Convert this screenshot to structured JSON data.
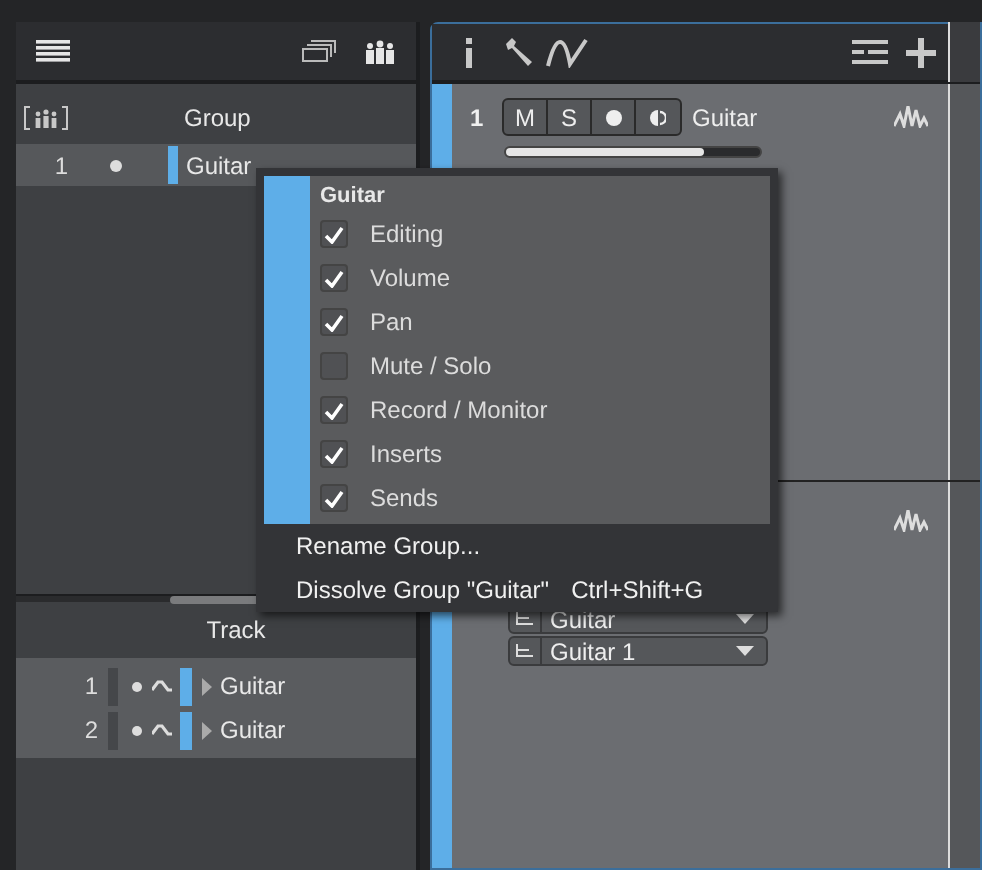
{
  "group_panel": {
    "header": "Group",
    "groups": [
      {
        "number": "1",
        "name": "Guitar",
        "color": "#5eaee8",
        "selected": true
      }
    ]
  },
  "track_panel": {
    "header": "Track",
    "tracks": [
      {
        "number": "1",
        "name": "Guitar",
        "color": "#5eaee8"
      },
      {
        "number": "2",
        "name": "Guitar",
        "color": "#5eaee8"
      }
    ]
  },
  "console": {
    "tracks": [
      {
        "number": "1",
        "kind": "channel",
        "color": "#5eaee8",
        "buttons": [
          "M",
          "S"
        ],
        "name": "Guitar",
        "level": 0.78
      },
      {
        "kind": "sends",
        "color": "#5eaee8",
        "dropdowns": [
          "Guitar",
          "Guitar 1"
        ]
      }
    ]
  },
  "context_menu": {
    "title": "Guitar",
    "color": "#5eaee8",
    "options": [
      {
        "label": "Editing",
        "checked": true
      },
      {
        "label": "Volume",
        "checked": true
      },
      {
        "label": "Pan",
        "checked": true
      },
      {
        "label": "Mute / Solo",
        "checked": false
      },
      {
        "label": "Record / Monitor",
        "checked": true
      },
      {
        "label": "Inserts",
        "checked": true
      },
      {
        "label": "Sends",
        "checked": true
      }
    ],
    "items": [
      {
        "label": "Rename Group..."
      },
      {
        "label": "Dissolve Group \"Guitar\"",
        "shortcut": "Ctrl+Shift+G"
      }
    ]
  }
}
